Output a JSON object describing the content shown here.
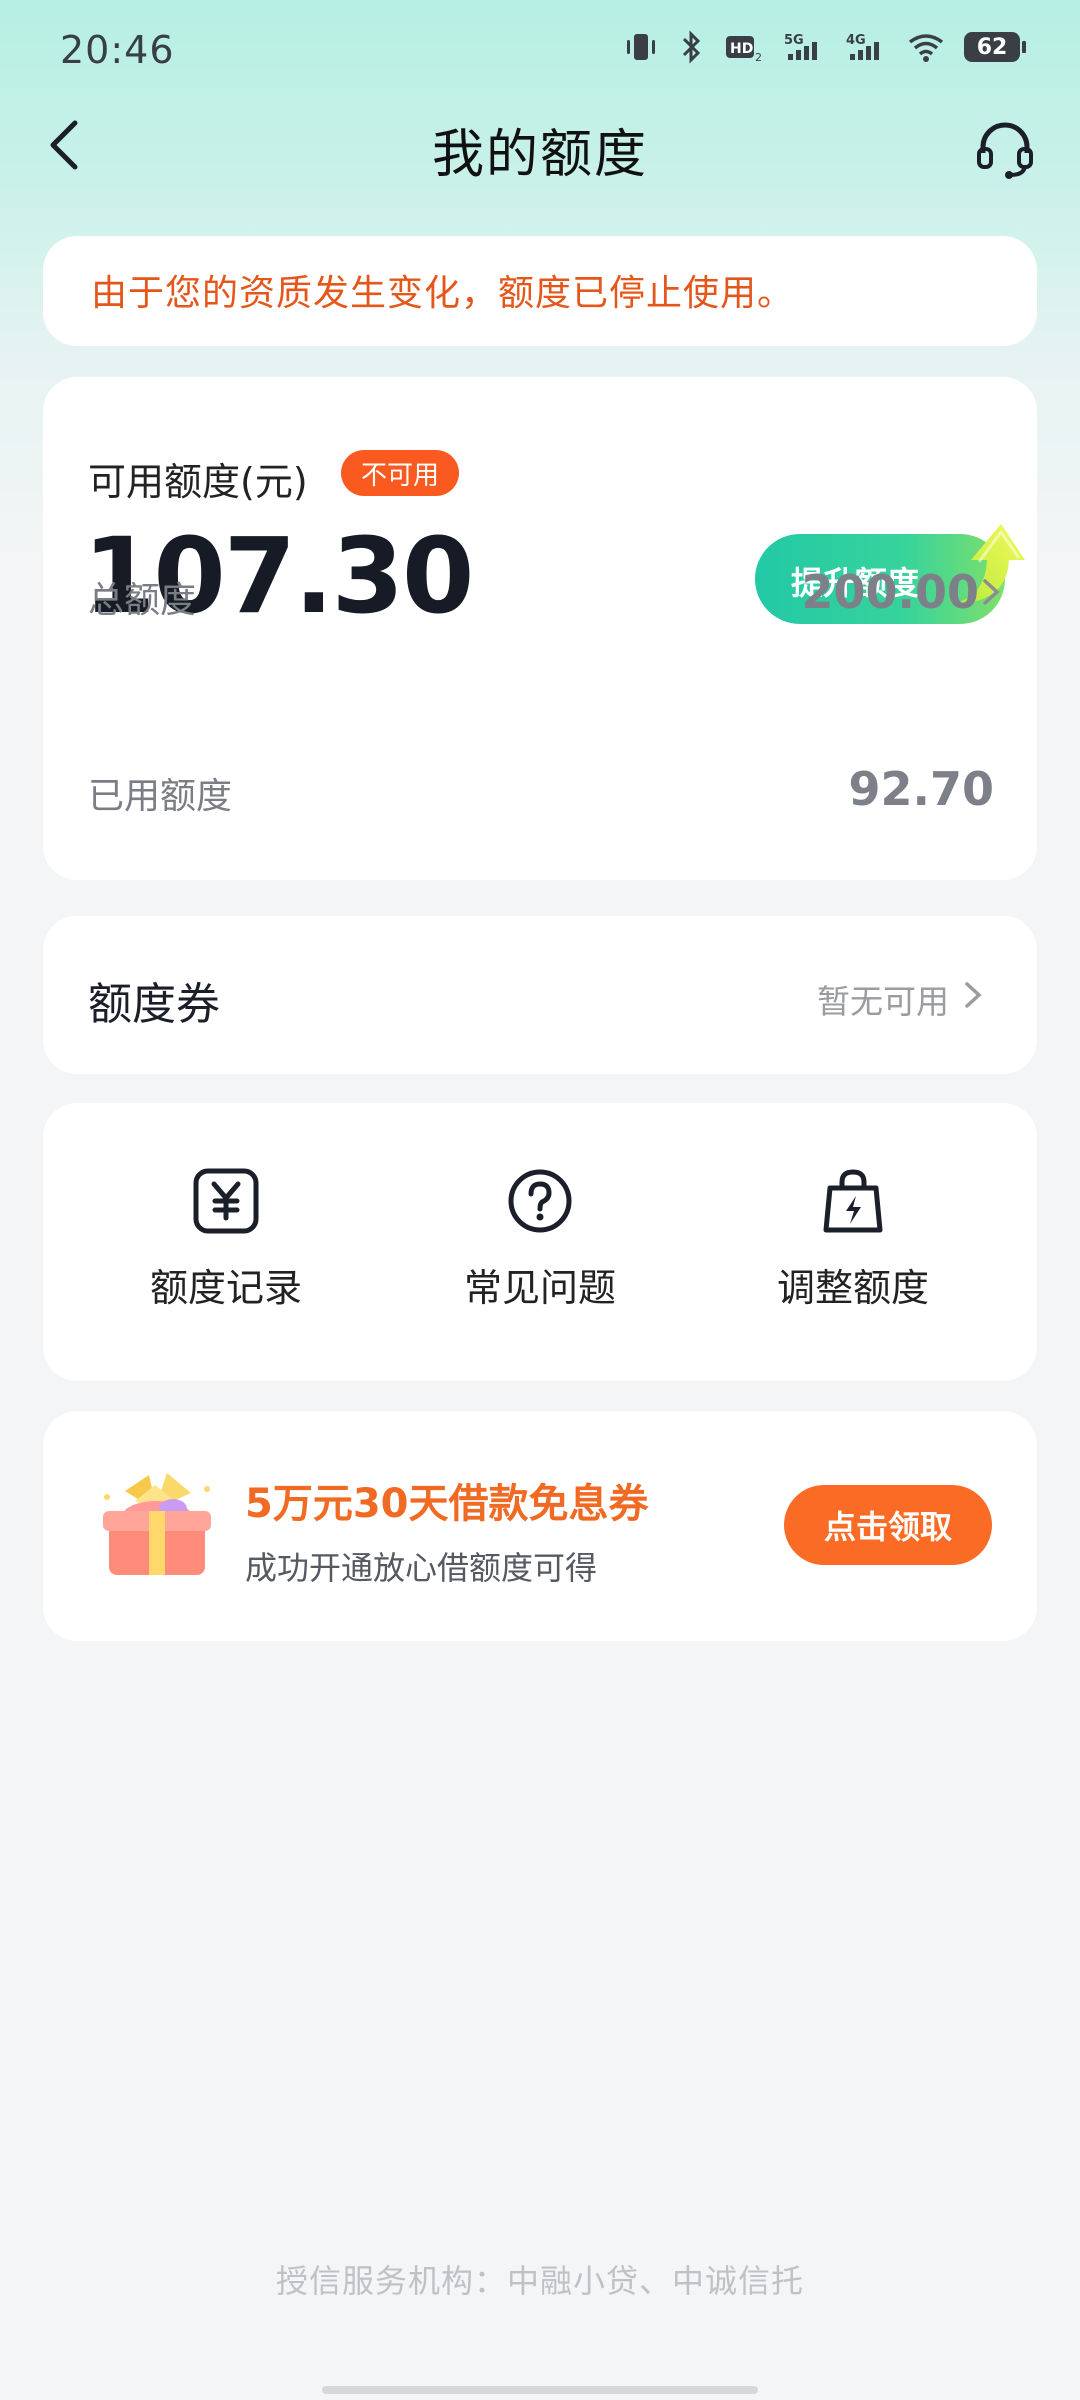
{
  "status_bar": {
    "time": "20:46",
    "battery": "62",
    "network_5g": "5G",
    "network_4g": "4G",
    "hd_label": "HD"
  },
  "nav": {
    "title": "我的额度",
    "back_icon": "chevron-left-icon",
    "service_icon": "headset-icon"
  },
  "notice": {
    "text": "由于您的资质发生变化，额度已停止使用。",
    "color": "#e4561a"
  },
  "quota": {
    "label": "可用额度(元)",
    "badge": "不可用",
    "amount": "107.30",
    "boost_button": "提升额度",
    "total_label": "总额度",
    "total_value": "200.00",
    "used_label": "已用额度",
    "used_value": "92.70"
  },
  "voucher": {
    "title": "额度券",
    "status": "暂无可用"
  },
  "tools": [
    {
      "label": "额度记录",
      "icon": "yuan-receipt-icon"
    },
    {
      "label": "常见问题",
      "icon": "question-circle-icon"
    },
    {
      "label": "调整额度",
      "icon": "lightning-bag-icon"
    }
  ],
  "promo": {
    "title": "5万元30天借款免息券",
    "subtitle": "成功开通放心借额度可得",
    "button": "点击领取",
    "icon": "gift-box-icon"
  },
  "footer": {
    "text": "授信服务机构：中融小贷、中诚信托"
  },
  "colors": {
    "accent_orange": "#fa6b25",
    "accent_green": "#22c9a5"
  }
}
